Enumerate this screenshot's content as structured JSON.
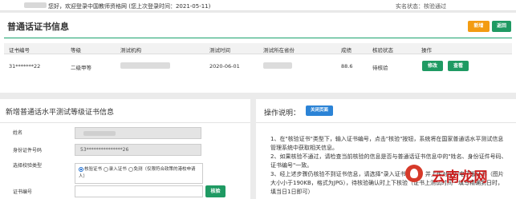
{
  "topbar": {
    "welcome": "您好，欢迎登录中国教师资格网 (您上次登录时间：2021-05-11)",
    "status": "实名状态：核验通过"
  },
  "certificate": {
    "title": "普通话证书信息",
    "new_button": "新增",
    "back_button": "返回",
    "columns": [
      "证书编号",
      "等级",
      "测试机构",
      "测试时间",
      "测试所在省份",
      "成绩",
      "核验状态",
      "操作"
    ],
    "row": {
      "cert_no": "31*******22",
      "level": "二级甲等",
      "test_date": "2020-06-01",
      "score": "88.6",
      "status": "待核验",
      "edit_button": "修改",
      "view_button": "查看"
    }
  },
  "form": {
    "title": "新增普通话水平测试等级证书信息",
    "name_label": "姓名",
    "id_label": "身份证件号码",
    "id_value": "53***************26",
    "verify_type_label": "选择校验类型",
    "radio_options": [
      "核验证书",
      "录入证书",
      "免测（仅限符合政策的港校申请人）"
    ],
    "cert_no_label": "证书编号",
    "verify_button": "核验"
  },
  "help": {
    "title": "操作说明：",
    "close_button": "关闭页面",
    "lines": [
      "1、在\"核验证书\"类型下，输入证书编号，点击\"核验\"按钮，系统将在国家普通话水平测试信息管理系统中获取相关信息。",
      "2、如果核验不通过，请检查当前核验的信息是否与普通话证书信息中的\"姓名、身份证件号码、证书编号\"一致。",
      "3、经上述步骤仍核验不到证书信息，请选择\"录入证书\"类型，并上传对应的电子版证书（图片大小小于190KB，格式为JPG），待核验确认时上下核验（证书上测试时间一填写精确到日时，填当日1日即可）"
    ]
  },
  "watermark": "云南龙网"
}
